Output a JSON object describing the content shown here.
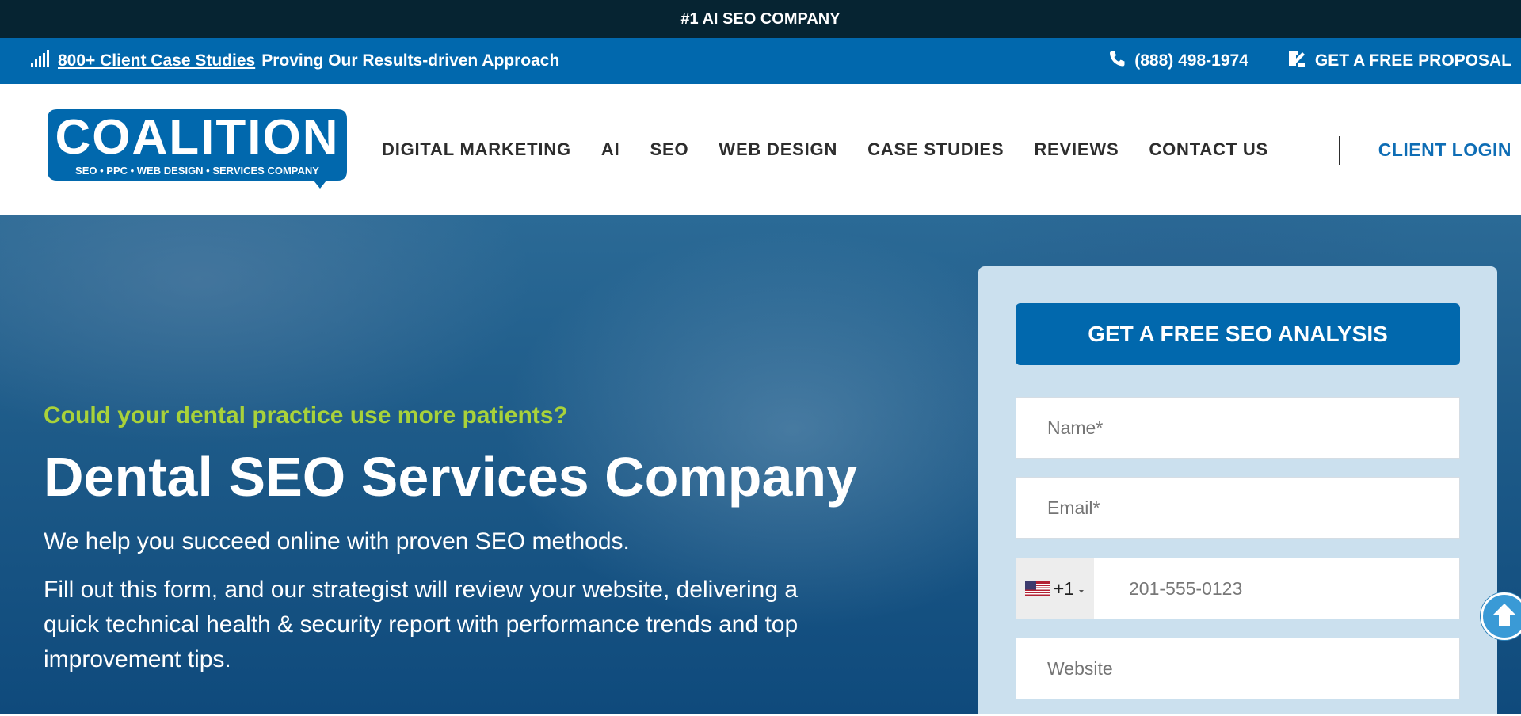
{
  "topbar": {
    "text": "#1 AI SEO COMPANY"
  },
  "bluebar": {
    "case_studies_link": "800+ Client Case Studies",
    "tagline": "Proving Our Results-driven Approach",
    "phone": "(888) 498-1974",
    "proposal": "GET A FREE PROPOSAL"
  },
  "logo": {
    "name": "COALITION",
    "tagline": "SEO • PPC • WEB DESIGN • SERVICES COMPANY"
  },
  "nav": {
    "items": [
      {
        "label": "DIGITAL MARKETING"
      },
      {
        "label": "AI"
      },
      {
        "label": "SEO"
      },
      {
        "label": "WEB DESIGN"
      },
      {
        "label": "CASE STUDIES"
      },
      {
        "label": "REVIEWS"
      },
      {
        "label": "CONTACT US"
      }
    ],
    "login": "CLIENT LOGIN"
  },
  "hero": {
    "eyebrow": "Could your dental practice use more patients?",
    "title": "Dental SEO Services Company",
    "subtitle": "We help you succeed online with proven SEO methods.",
    "description": "Fill out this form, and our strategist will review your website, delivering a quick technical health & security report with performance trends and top improvement tips."
  },
  "form": {
    "button": "GET A FREE SEO ANALYSIS",
    "name_placeholder": "Name*",
    "email_placeholder": "Email*",
    "phone_prefix": "+1",
    "phone_placeholder": "201-555-0123",
    "website_placeholder": "Website"
  },
  "colors": {
    "topbar_bg": "#062432",
    "bluebar_bg": "#0168ad",
    "accent_green": "#a9d23a",
    "login_blue": "#0e6db5"
  },
  "icons": {
    "signal": "signal-bars-icon",
    "phone": "phone-icon",
    "proposal": "proposal-document-icon",
    "scroll_top": "arrow-up-icon",
    "flag": "us-flag-icon"
  }
}
